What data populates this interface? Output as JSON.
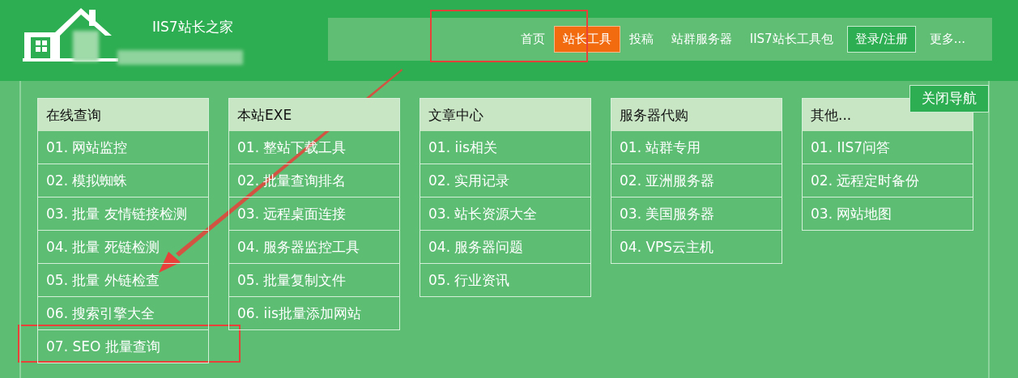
{
  "site": {
    "title": "IIS7站长之家",
    "subtitle_blurred": true
  },
  "nav": [
    {
      "label": "首页",
      "kind": "link",
      "selected": false
    },
    {
      "label": "站长工具",
      "kind": "link",
      "selected": true
    },
    {
      "label": "投稿",
      "kind": "link",
      "selected": false
    },
    {
      "label": "站群服务器",
      "kind": "link",
      "selected": false
    },
    {
      "label": "IIS7站长工具包",
      "kind": "link",
      "selected": false
    },
    {
      "label": "登录/注册",
      "kind": "button",
      "selected": false
    },
    {
      "label": "更多...",
      "kind": "link",
      "selected": false
    }
  ],
  "close_button": "关闭导航",
  "menus": [
    {
      "title": "在线查询",
      "items": [
        "01. 网站监控",
        "02. 模拟蜘蛛",
        "03. 批量 友情链接检测",
        "04. 批量 死链检测",
        "05. 批量 外链检查",
        "06. 搜索引擎大全",
        "07. SEO 批量查询"
      ]
    },
    {
      "title": "本站EXE",
      "items": [
        "01. 整站下载工具",
        "02. 批量查询排名",
        "03. 远程桌面连接",
        "04. 服务器监控工具",
        "05. 批量复制文件",
        "06. iis批量添加网站"
      ]
    },
    {
      "title": "文章中心",
      "items": [
        "01. iis相关",
        "02. 实用记录",
        "03. 站长资源大全",
        "04. 服务器问题",
        "05. 行业资讯"
      ]
    },
    {
      "title": "服务器代购",
      "items": [
        "01. 站群专用",
        "02. 亚洲服务器",
        "03. 美国服务器",
        "04. VPS云主机"
      ]
    },
    {
      "title": "其他...",
      "items": [
        "01. IIS7问答",
        "02. 远程定时备份",
        "03. 网站地图"
      ]
    }
  ],
  "annotations": [
    {
      "kind": "frame"
    },
    {
      "kind": "frame"
    },
    {
      "kind": "arrow"
    }
  ]
}
